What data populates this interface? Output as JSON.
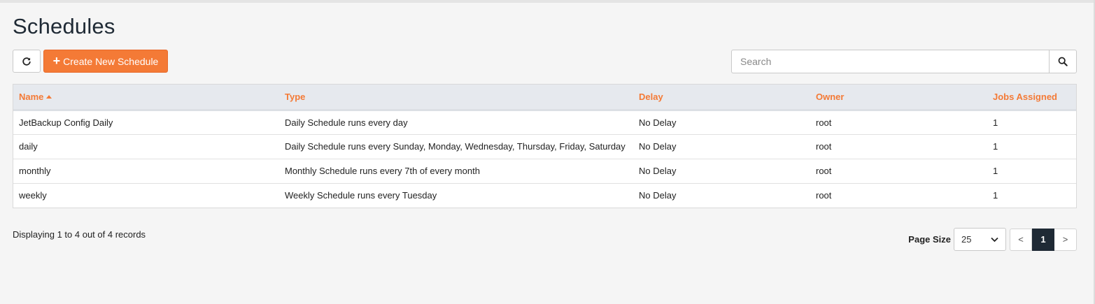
{
  "page": {
    "title": "Schedules"
  },
  "toolbar": {
    "refresh_icon": "refresh-icon",
    "create_label": "Create New Schedule",
    "search_placeholder": "Search",
    "search_icon": "search-icon",
    "accent_color": "#f47a36"
  },
  "table": {
    "columns": [
      {
        "label": "Name",
        "sorted": "asc"
      },
      {
        "label": "Type"
      },
      {
        "label": "Delay"
      },
      {
        "label": "Owner"
      },
      {
        "label": "Jobs Assigned"
      }
    ],
    "rows": [
      {
        "name": "JetBackup Config Daily",
        "type": "Daily Schedule runs every day",
        "delay": "No Delay",
        "owner": "root",
        "jobs": "1"
      },
      {
        "name": "daily",
        "type": "Daily Schedule runs every Sunday, Monday, Wednesday, Thursday, Friday, Saturday",
        "delay": "No Delay",
        "owner": "root",
        "jobs": "1"
      },
      {
        "name": "monthly",
        "type": "Monthly Schedule runs every 7th of every month",
        "delay": "No Delay",
        "owner": "root",
        "jobs": "1"
      },
      {
        "name": "weekly",
        "type": "Weekly Schedule runs every Tuesday",
        "delay": "No Delay",
        "owner": "root",
        "jobs": "1"
      }
    ]
  },
  "footer": {
    "records_info": "Displaying 1 to 4 out of 4 records",
    "page_size_label": "Page Size",
    "page_size_value": "25",
    "prev_label": "<",
    "current_page": "1",
    "next_label": ">",
    "current_page_color": "#1f2a35"
  }
}
